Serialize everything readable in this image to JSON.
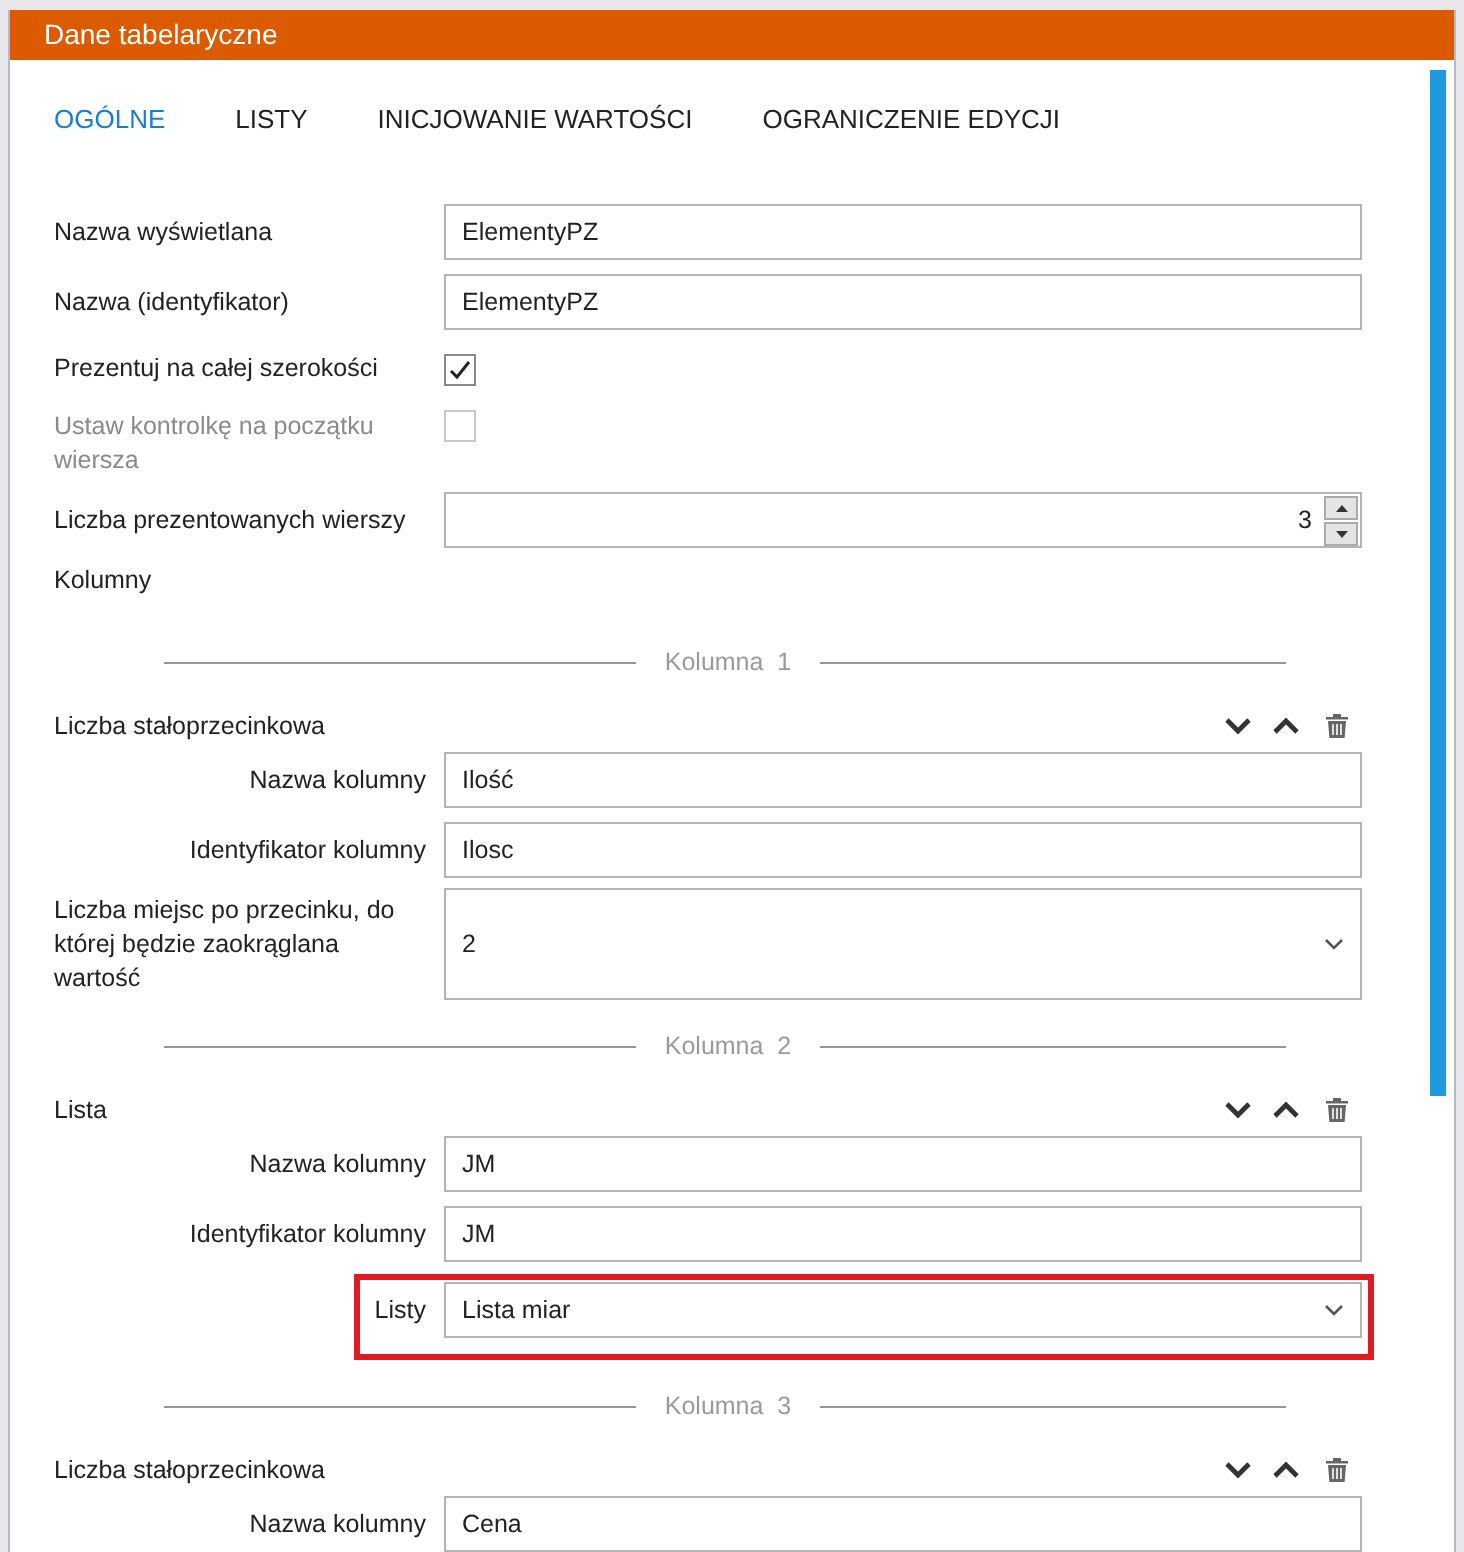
{
  "window": {
    "title": "Dane tabelaryczne"
  },
  "tabs": [
    {
      "label": "OGÓLNE",
      "selected": true
    },
    {
      "label": "LISTY",
      "selected": false
    },
    {
      "label": "INICJOWANIE WARTOŚCI",
      "selected": false
    },
    {
      "label": "OGRANICZENIE EDYCJI",
      "selected": false
    }
  ],
  "general_fields": [
    {
      "kind": "text",
      "label": "Nazwa wyświetlana",
      "value": "ElementyPZ"
    },
    {
      "kind": "text",
      "label": "Nazwa (identyfikator)",
      "value": "ElementyPZ"
    },
    {
      "kind": "checkbox",
      "label": "Prezentuj na całej szerokości",
      "checked": true,
      "disabled": false
    },
    {
      "kind": "checkbox",
      "label": "Ustaw kontrolkę na początku wiersza",
      "checked": false,
      "disabled": true
    },
    {
      "kind": "number",
      "label": "Liczba prezentowanych wierszy",
      "value": "3"
    }
  ],
  "columns_heading": "Kolumny",
  "columns": [
    {
      "divider_label": "Kolumna",
      "number": "1",
      "type": "Liczba stałoprzecinkowa",
      "fields": [
        {
          "kind": "text",
          "label": "Nazwa kolumny",
          "value": "Ilość",
          "highlighted": false
        },
        {
          "kind": "text",
          "label": "Identyfikator kolumny",
          "value": "Ilosc",
          "highlighted": false
        },
        {
          "kind": "select",
          "label": "Liczba miejsc po przecinku, do której będzie zaokrąglana wartość",
          "value": "2",
          "highlighted": false
        }
      ]
    },
    {
      "divider_label": "Kolumna",
      "number": "2",
      "type": "Lista",
      "fields": [
        {
          "kind": "text",
          "label": "Nazwa kolumny",
          "value": "JM",
          "highlighted": false
        },
        {
          "kind": "text",
          "label": "Identyfikator kolumny",
          "value": "JM",
          "highlighted": false
        },
        {
          "kind": "select",
          "label": "Listy",
          "value": "Lista miar",
          "highlighted": true
        }
      ]
    },
    {
      "divider_label": "Kolumna",
      "number": "3",
      "type": "Liczba stałoprzecinkowa",
      "fields": [
        {
          "kind": "text",
          "label": "Nazwa kolumny",
          "value": "Cena",
          "highlighted": false
        }
      ]
    }
  ]
}
